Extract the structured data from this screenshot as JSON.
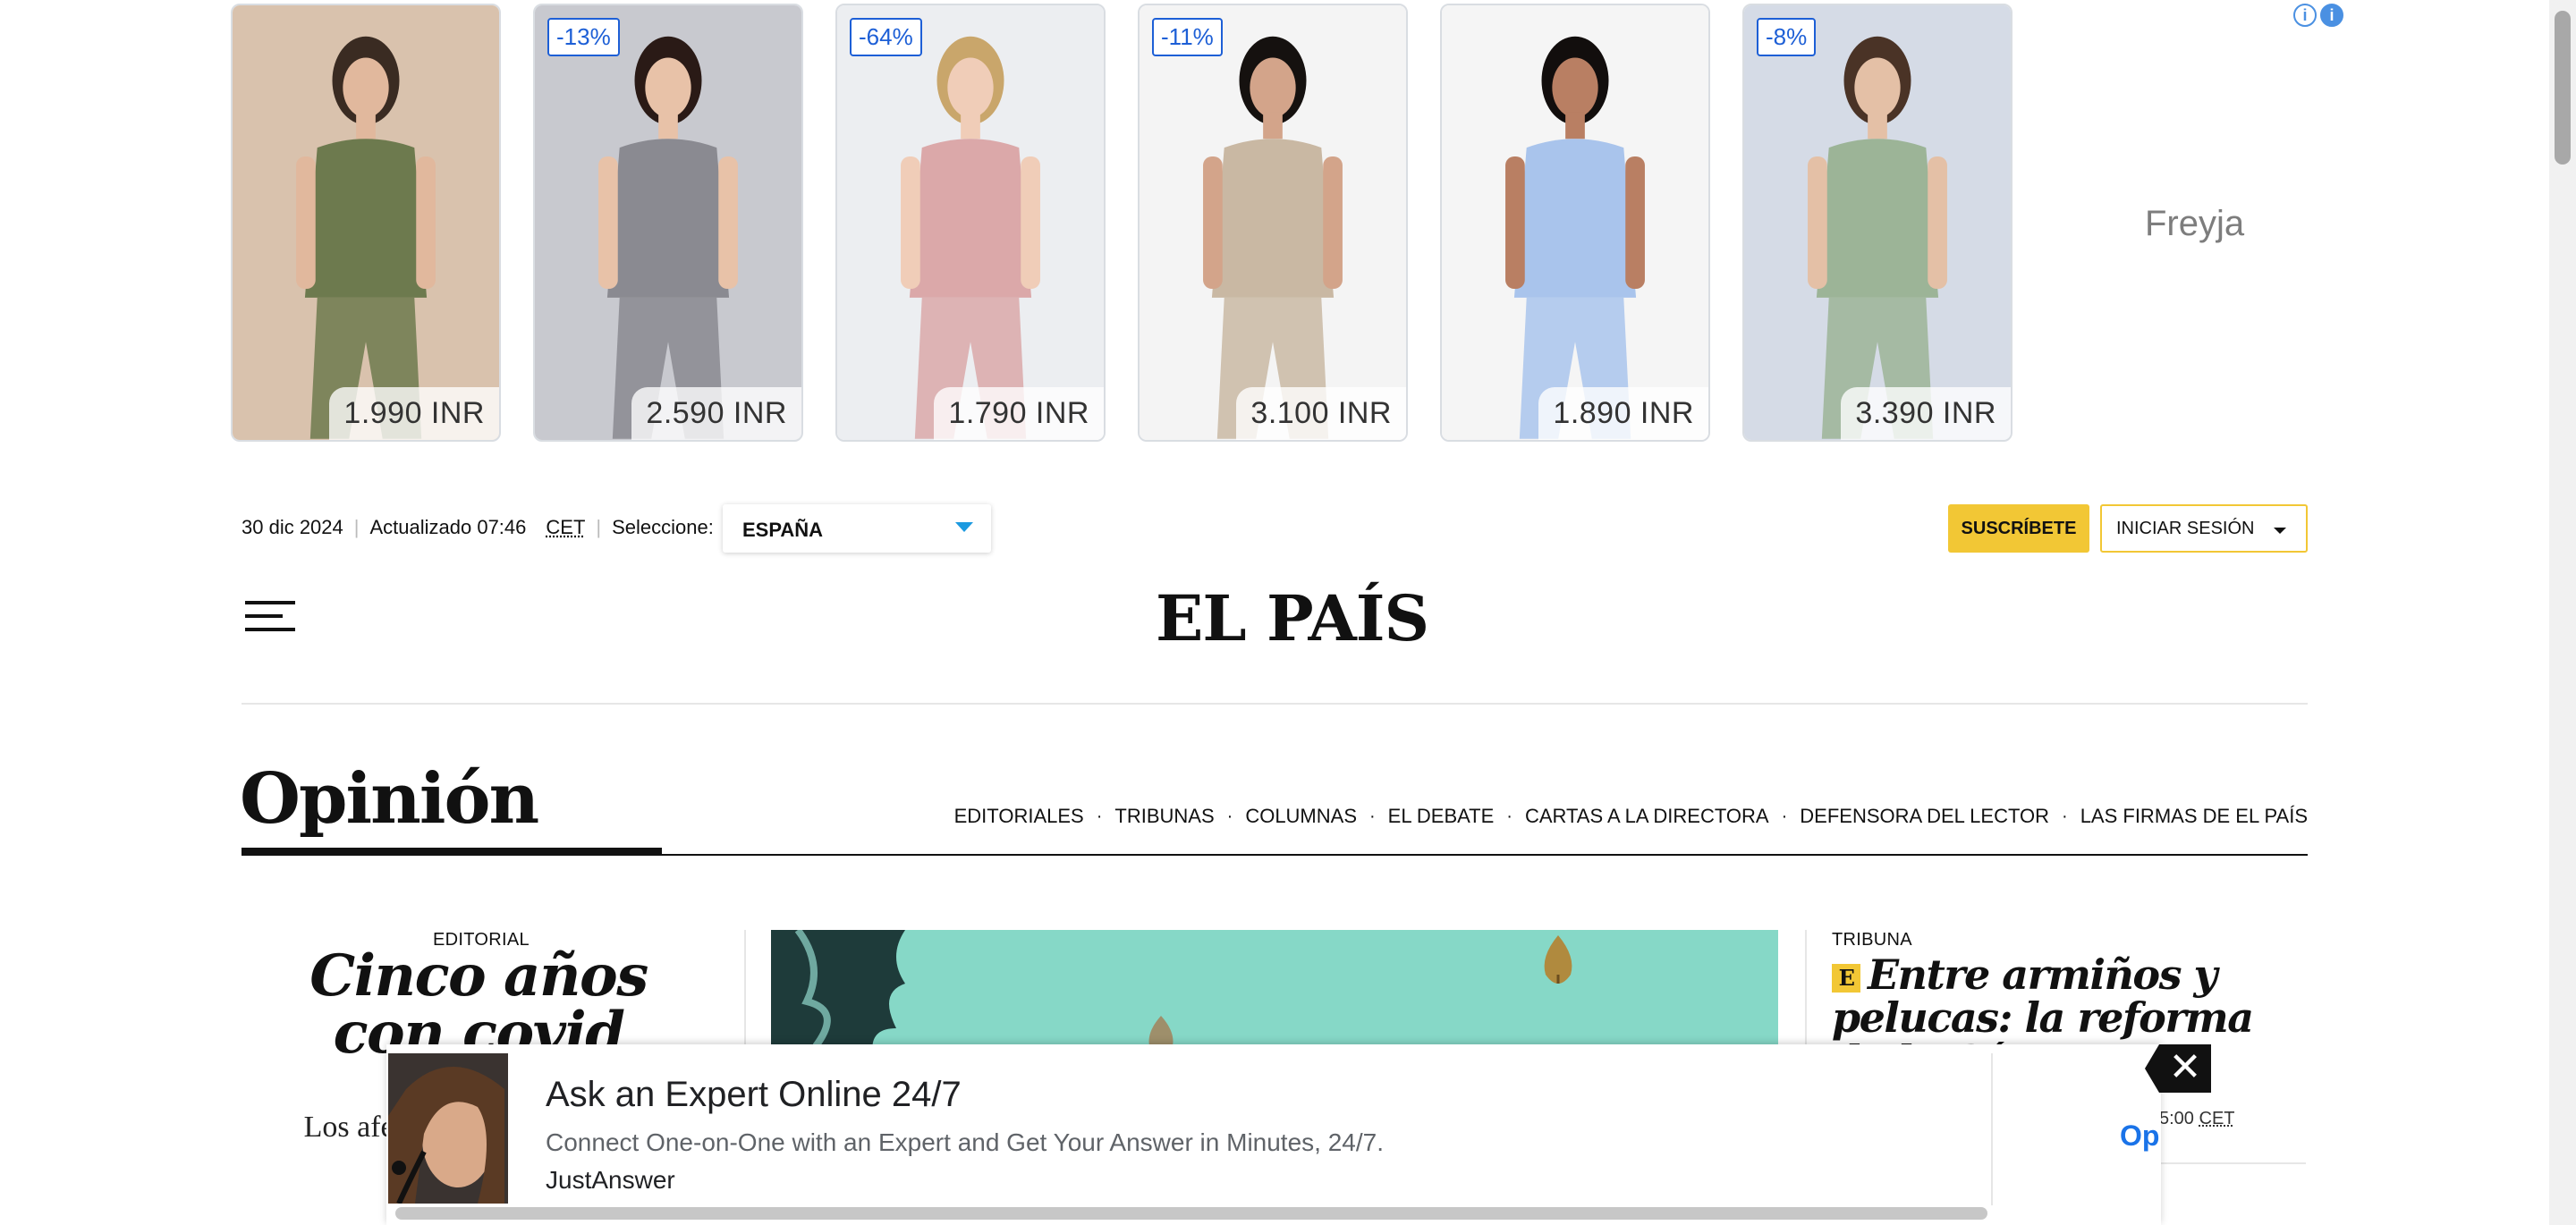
{
  "ad_strip": {
    "products": [
      {
        "badge": "",
        "price": "1.990 INR",
        "bg": "#d9c2ad",
        "cloth": "#6d7a4e",
        "skin": "#e1b89d",
        "hair": "#3a2b22"
      },
      {
        "badge": "-13%",
        "price": "2.590 INR",
        "bg": "#c8c9cf",
        "cloth": "#8a8a91",
        "skin": "#e8c2a8",
        "hair": "#2a1a16"
      },
      {
        "badge": "-64%",
        "price": "1.790 INR",
        "bg": "#eceef1",
        "cloth": "#dba8a9",
        "skin": "#f0cdb8",
        "hair": "#c9a66b"
      },
      {
        "badge": "-11%",
        "price": "3.100 INR",
        "bg": "#f4f4f4",
        "cloth": "#c9b8a3",
        "skin": "#d3a48a",
        "hair": "#15110f"
      },
      {
        "badge": "",
        "price": "1.890 INR",
        "bg": "#f5f5f5",
        "cloth": "#a9c4ec",
        "skin": "#b97f63",
        "hair": "#120e0d"
      },
      {
        "badge": "-8%",
        "price": "3.390 INR",
        "bg": "#d5dbe6",
        "cloth": "#9cb497",
        "skin": "#e4c0a6",
        "hair": "#4a3326"
      }
    ],
    "brand": "Freyja",
    "info_icon": "info-icon",
    "adchoices_icon": "adchoices-icon"
  },
  "topbar": {
    "date": "30 dic 2024",
    "updated": "Actualizado 07:46",
    "timezone": "CET",
    "select_label": "Seleccione:",
    "edition": "ESPAÑA",
    "subscribe": "SUSCRÍBETE",
    "login": "INICIAR SESIÓN"
  },
  "header": {
    "logo": "EL PAÍS",
    "menu_icon": "hamburger-menu-icon"
  },
  "section": {
    "title": "Opinión",
    "nav": [
      "EDITORIALES",
      "TRIBUNAS",
      "COLUMNAS",
      "EL DEBATE",
      "CARTAS A LA DIRECTORA",
      "DEFENSORA DEL LECTOR",
      "LAS FIRMAS DE EL PAÍS"
    ]
  },
  "articles": {
    "left": {
      "kicker": "EDITORIAL",
      "headline": "Cinco años con covid",
      "body": "Los afec persistent una sanid"
    },
    "right": {
      "kicker": "TRIBUNA",
      "badge": "E",
      "headline": "Entre armiños y pelucas: la reforma de la Cámara",
      "time": "5:00",
      "timezone": "CET"
    }
  },
  "bottom_ad": {
    "title": "Ask an Expert Online 24/7",
    "description": "Connect One-on-One with an Expert and Get Your Answer in Minutes, 24/7.",
    "advertiser": "JustAnswer",
    "cta": "Op",
    "close": "✕"
  },
  "colors": {
    "accent_yellow": "#f2c735",
    "link_blue": "#1c9ae0",
    "illustration_bg": "#86d8c7"
  }
}
